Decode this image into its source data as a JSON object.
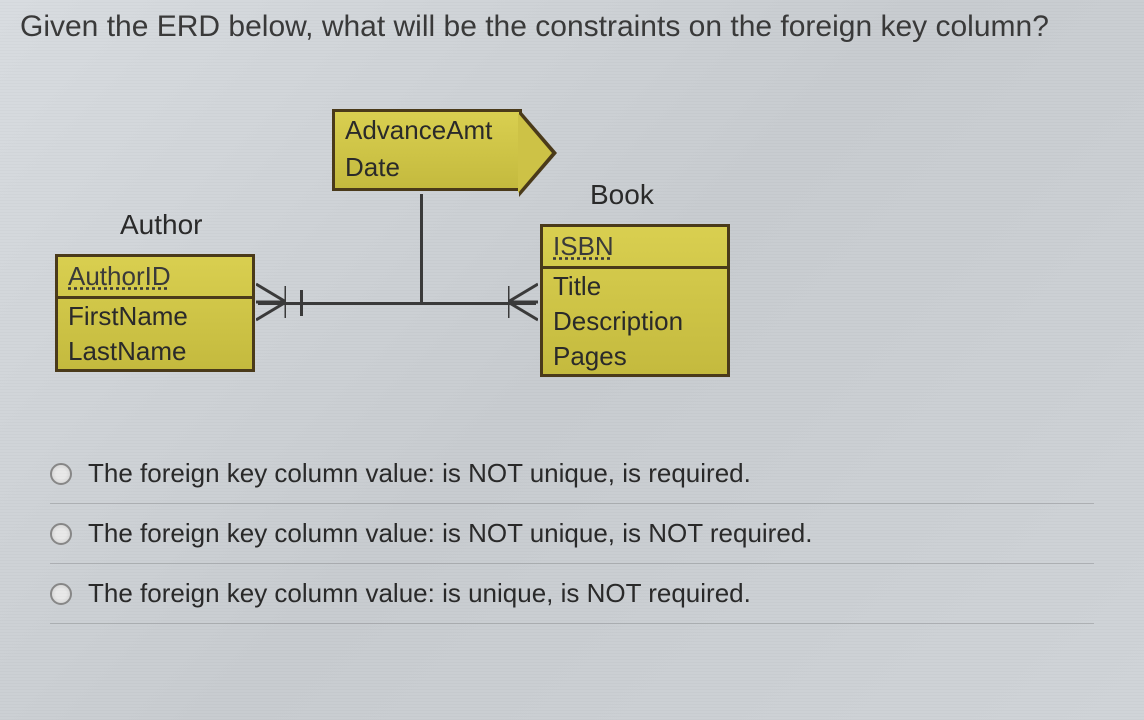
{
  "question": "Given the ERD below, what will be the constraints on the foreign key column?",
  "erd": {
    "entity_author": {
      "label": "Author",
      "pk": "AuthorID",
      "attrs": [
        "FirstName",
        "LastName"
      ]
    },
    "entity_book": {
      "label": "Book",
      "pk": "ISBN",
      "attrs": [
        "Title",
        "Description",
        "Pages"
      ]
    },
    "relationship": {
      "attrs": [
        "AdvanceAmt",
        "Date"
      ]
    }
  },
  "options": [
    {
      "text": "The foreign key column value: is NOT unique, is required."
    },
    {
      "text": "The foreign key column value: is NOT unique, is NOT required."
    },
    {
      "text": "The foreign key column value: is unique, is NOT required."
    }
  ],
  "chart_data": {
    "type": "erd",
    "entities": [
      {
        "name": "Author",
        "primary_key": "AuthorID",
        "attributes": [
          "FirstName",
          "LastName"
        ]
      },
      {
        "name": "Book",
        "primary_key": "ISBN",
        "attributes": [
          "Title",
          "Description",
          "Pages"
        ]
      }
    ],
    "relationships": [
      {
        "between": [
          "Author",
          "Book"
        ],
        "attributes": [
          "AdvanceAmt",
          "Date"
        ],
        "cardinality": {
          "Author": "many",
          "Book": "many"
        }
      }
    ]
  }
}
